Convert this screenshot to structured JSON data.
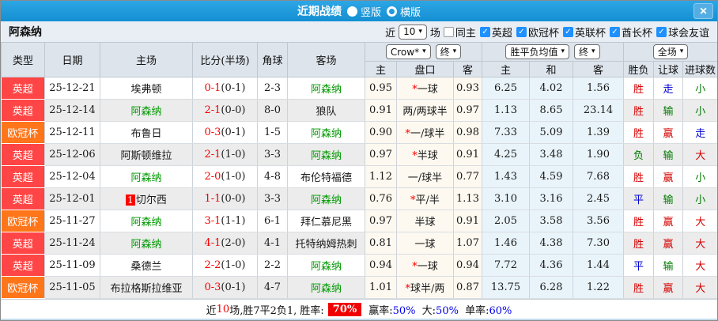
{
  "window": {
    "title": "近期战绩",
    "view_options": [
      {
        "label": "竖版",
        "selected": true
      },
      {
        "label": "横版",
        "selected": false
      }
    ]
  },
  "icons": {
    "caret": "▾",
    "check": "✓",
    "close": "×"
  },
  "team": {
    "name": "阿森纳",
    "highlight_color": "#009900"
  },
  "filter": {
    "recent_label": "近",
    "count_value": "10",
    "unit_label": "场",
    "checkboxes": [
      {
        "label": "同主",
        "checked": false
      },
      {
        "label": "英超",
        "checked": true
      },
      {
        "label": "欧冠杯",
        "checked": true
      },
      {
        "label": "英联杯",
        "checked": true
      },
      {
        "label": "酋长杯",
        "checked": true
      },
      {
        "label": "球会友谊",
        "checked": true
      }
    ]
  },
  "table": {
    "left_headers": [
      "类型",
      "日期",
      "主场",
      "比分(半场)",
      "角球",
      "客场"
    ],
    "odds_dropdowns": [
      {
        "label": "Crow*"
      },
      {
        "label": "终"
      }
    ],
    "odds_subheaders": [
      "主",
      "盘口",
      "客"
    ],
    "avg_dropdowns": [
      {
        "label": "胜平负均值"
      },
      {
        "label": "终"
      }
    ],
    "avg_subheaders": [
      "主",
      "和",
      "客"
    ],
    "result_dropdowns": [
      {
        "label": "全场"
      }
    ],
    "result_subheaders": [
      "胜负",
      "让球",
      "进球数"
    ]
  },
  "type_colors": {
    "英超": "#ff4545",
    "欧冠杯": "#ff7519"
  },
  "value_colors": {
    "胜": "#d40000",
    "赢": "#d40000",
    "大": "#d40000",
    "平": "#0000d4",
    "走": "#0000d4",
    "负": "#007a00",
    "输": "#007a00",
    "小": "#007a00"
  },
  "rows": [
    {
      "type": "英超",
      "date": "25-12-21",
      "home": "埃弗顿",
      "score": "0-1",
      "half": "(0-1)",
      "corner": "2-3",
      "away": "阿森纳",
      "odds": [
        "0.95",
        "*一球",
        "0.93"
      ],
      "avg": [
        "6.25",
        "4.02",
        "1.56"
      ],
      "outcome": [
        "胜",
        "走",
        "小"
      ]
    },
    {
      "type": "英超",
      "date": "25-12-14",
      "home": "阿森纳",
      "score": "2-1",
      "half": "(0-0)",
      "corner": "8-0",
      "away": "狼队",
      "odds": [
        "0.91",
        "两/两球半",
        "0.97"
      ],
      "avg": [
        "1.13",
        "8.65",
        "23.14"
      ],
      "outcome": [
        "胜",
        "输",
        "小"
      ]
    },
    {
      "type": "欧冠杯",
      "date": "25-12-11",
      "home": "布鲁日",
      "score": "0-3",
      "half": "(0-1)",
      "corner": "1-5",
      "away": "阿森纳",
      "odds": [
        "0.90",
        "*一/球半",
        "0.98"
      ],
      "avg": [
        "7.33",
        "5.09",
        "1.39"
      ],
      "outcome": [
        "胜",
        "赢",
        "走"
      ]
    },
    {
      "type": "英超",
      "date": "25-12-06",
      "home": "阿斯顿维拉",
      "score": "2-1",
      "half": "(1-0)",
      "corner": "3-3",
      "away": "阿森纳",
      "odds": [
        "0.97",
        "*半球",
        "0.91"
      ],
      "avg": [
        "4.25",
        "3.48",
        "1.90"
      ],
      "outcome": [
        "负",
        "输",
        "大"
      ]
    },
    {
      "type": "英超",
      "date": "25-12-04",
      "home": "阿森纳",
      "score": "2-0",
      "half": "(1-0)",
      "corner": "4-8",
      "away": "布伦特福德",
      "odds": [
        "1.12",
        "一/球半",
        "0.77"
      ],
      "avg": [
        "1.43",
        "4.59",
        "7.68"
      ],
      "outcome": [
        "胜",
        "赢",
        "小"
      ]
    },
    {
      "type": "英超",
      "date": "25-12-01",
      "home_rank": "1",
      "home": "切尔西",
      "score": "1-1",
      "half": "(0-0)",
      "corner": "3-3",
      "away": "阿森纳",
      "odds": [
        "0.76",
        "*平/半",
        "1.13"
      ],
      "avg": [
        "3.10",
        "3.16",
        "2.45"
      ],
      "outcome": [
        "平",
        "输",
        "小"
      ]
    },
    {
      "type": "欧冠杯",
      "date": "25-11-27",
      "home": "阿森纳",
      "score": "3-1",
      "half": "(1-1)",
      "corner": "6-1",
      "away": "拜仁慕尼黑",
      "odds": [
        "0.97",
        "半球",
        "0.91"
      ],
      "avg": [
        "2.05",
        "3.58",
        "3.56"
      ],
      "outcome": [
        "胜",
        "赢",
        "大"
      ]
    },
    {
      "type": "英超",
      "date": "25-11-24",
      "home": "阿森纳",
      "score": "4-1",
      "half": "(2-0)",
      "corner": "4-1",
      "away": "托特纳姆热刺",
      "odds": [
        "0.81",
        "一球",
        "1.07"
      ],
      "avg": [
        "1.46",
        "4.38",
        "7.30"
      ],
      "outcome": [
        "胜",
        "赢",
        "大"
      ]
    },
    {
      "type": "英超",
      "date": "25-11-09",
      "home": "桑德兰",
      "score": "2-2",
      "half": "(1-0)",
      "corner": "2-2",
      "away": "阿森纳",
      "odds": [
        "0.94",
        "*一球",
        "0.94"
      ],
      "avg": [
        "7.72",
        "4.36",
        "1.44"
      ],
      "outcome": [
        "平",
        "输",
        "大"
      ]
    },
    {
      "type": "欧冠杯",
      "date": "25-11-05",
      "home": "布拉格斯拉维亚",
      "score": "0-3",
      "half": "(0-1)",
      "corner": "4-7",
      "away": "阿森纳",
      "odds": [
        "1.01",
        "*球半/两",
        "0.87"
      ],
      "avg": [
        "13.75",
        "6.28",
        "1.22"
      ],
      "outcome": [
        "胜",
        "赢",
        "大"
      ]
    }
  ],
  "footer": {
    "prefix": "近",
    "count": "10",
    "mid": "场,胜7平2负1, 胜率:",
    "win_rate": "70%",
    "stats": [
      {
        "label": "赢率:",
        "value": "50%"
      },
      {
        "label": " 大:",
        "value": "50%"
      },
      {
        "label": " 单率:",
        "value": "60%"
      }
    ]
  }
}
